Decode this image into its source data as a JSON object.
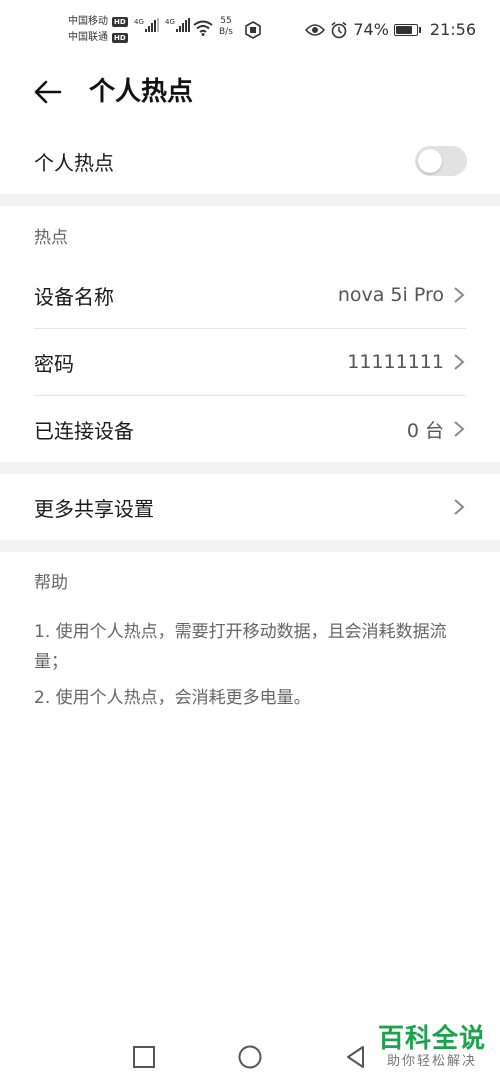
{
  "status_bar": {
    "carrier1": "中国移动",
    "carrier2": "中国联通",
    "hd_badge": "HD",
    "network1": "4G",
    "network2": "4G",
    "speed_value": "55",
    "speed_unit": "B/s",
    "battery_percent": "74%",
    "battery_level": 0.74,
    "time": "21:56",
    "icons": [
      "signal-icon",
      "wifi-icon",
      "shield-icon",
      "eye-icon",
      "alarm-icon",
      "battery-icon"
    ]
  },
  "header": {
    "title": "个人热点"
  },
  "hotspot_toggle": {
    "label": "个人热点",
    "enabled": false
  },
  "hotspot_section": {
    "title": "热点",
    "items": [
      {
        "label": "设备名称",
        "value": "nova 5i Pro"
      },
      {
        "label": "密码",
        "value": "11111111"
      },
      {
        "label": "已连接设备",
        "value": "0 台"
      }
    ]
  },
  "more_settings": {
    "label": "更多共享设置"
  },
  "help": {
    "title": "帮助",
    "lines": [
      "1. 使用个人热点，需要打开移动数据，且会消耗数据流量；",
      "2. 使用个人热点，会消耗更多电量。"
    ]
  },
  "watermark": {
    "title": "百科全说",
    "subtitle": "助你轻松解决"
  },
  "colors": {
    "background": "#ffffff",
    "band": "#f3f3f3",
    "toggle_off": "#e2e2e2",
    "watermark_green": "#1aa34a"
  }
}
